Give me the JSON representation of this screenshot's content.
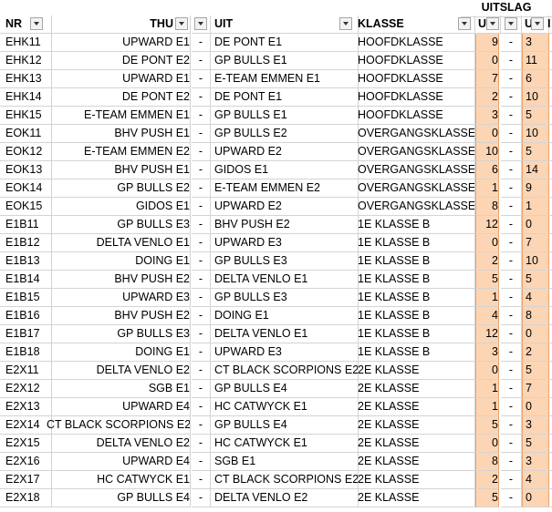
{
  "header": {
    "uitslag": "UITSLAG",
    "nr": "NR",
    "thuis": "THU",
    "uit": "UIT",
    "klasse": "KLASSE",
    "u1": "U",
    "u2": "U",
    "x": "I"
  },
  "highlight_color": "#fcd5b4",
  "rows": [
    {
      "nr": "EHK11",
      "thuis": "UPWARD E1",
      "sep": "-",
      "uit": "DE PONT E1",
      "klasse": "HOOFDKLASSE",
      "u1": "9",
      "dash": "-",
      "u2": "3"
    },
    {
      "nr": "EHK12",
      "thuis": "DE PONT E2",
      "sep": "-",
      "uit": "GP BULLS E1",
      "klasse": "HOOFDKLASSE",
      "u1": "0",
      "dash": "-",
      "u2": "11"
    },
    {
      "nr": "EHK13",
      "thuis": "UPWARD E1",
      "sep": "-",
      "uit": "E-TEAM EMMEN E1",
      "klasse": "HOOFDKLASSE",
      "u1": "7",
      "dash": "-",
      "u2": "6"
    },
    {
      "nr": "EHK14",
      "thuis": "DE PONT E2",
      "sep": "-",
      "uit": "DE PONT E1",
      "klasse": "HOOFDKLASSE",
      "u1": "2",
      "dash": "-",
      "u2": "10"
    },
    {
      "nr": "EHK15",
      "thuis": "E-TEAM EMMEN E1",
      "sep": "-",
      "uit": "GP BULLS E1",
      "klasse": "HOOFDKLASSE",
      "u1": "3",
      "dash": "-",
      "u2": "5"
    },
    {
      "nr": "EOK11",
      "thuis": "BHV PUSH E1",
      "sep": "-",
      "uit": "GP BULLS E2",
      "klasse": "OVERGANGSKLASSE",
      "u1": "0",
      "dash": "-",
      "u2": "10"
    },
    {
      "nr": "EOK12",
      "thuis": "E-TEAM EMMEN E2",
      "sep": "-",
      "uit": "UPWARD E2",
      "klasse": "OVERGANGSKLASSE",
      "u1": "10",
      "dash": "-",
      "u2": "5"
    },
    {
      "nr": "EOK13",
      "thuis": "BHV PUSH E1",
      "sep": "-",
      "uit": "GIDOS E1",
      "klasse": "OVERGANGSKLASSE",
      "u1": "6",
      "dash": "-",
      "u2": "14"
    },
    {
      "nr": "EOK14",
      "thuis": "GP BULLS E2",
      "sep": "-",
      "uit": "E-TEAM EMMEN E2",
      "klasse": "OVERGANGSKLASSE",
      "u1": "1",
      "dash": "-",
      "u2": "9"
    },
    {
      "nr": "EOK15",
      "thuis": "GIDOS E1",
      "sep": "-",
      "uit": "UPWARD E2",
      "klasse": "OVERGANGSKLASSE",
      "u1": "8",
      "dash": "-",
      "u2": "1"
    },
    {
      "nr": "E1B11",
      "thuis": "GP BULLS E3",
      "sep": "-",
      "uit": "BHV PUSH E2",
      "klasse": "1E KLASSE B",
      "u1": "12",
      "dash": "-",
      "u2": "0"
    },
    {
      "nr": "E1B12",
      "thuis": "DELTA VENLO E1",
      "sep": "-",
      "uit": "UPWARD E3",
      "klasse": "1E KLASSE B",
      "u1": "0",
      "dash": "-",
      "u2": "7"
    },
    {
      "nr": "E1B13",
      "thuis": "DOING E1",
      "sep": "-",
      "uit": "GP BULLS E3",
      "klasse": "1E KLASSE B",
      "u1": "2",
      "dash": "-",
      "u2": "10"
    },
    {
      "nr": "E1B14",
      "thuis": "BHV PUSH E2",
      "sep": "-",
      "uit": "DELTA VENLO E1",
      "klasse": "1E KLASSE B",
      "u1": "5",
      "dash": "-",
      "u2": "5"
    },
    {
      "nr": "E1B15",
      "thuis": "UPWARD E3",
      "sep": "-",
      "uit": "GP BULLS E3",
      "klasse": "1E KLASSE B",
      "u1": "1",
      "dash": "-",
      "u2": "4"
    },
    {
      "nr": "E1B16",
      "thuis": "BHV PUSH E2",
      "sep": "-",
      "uit": "DOING E1",
      "klasse": "1E KLASSE B",
      "u1": "4",
      "dash": "-",
      "u2": "8"
    },
    {
      "nr": "E1B17",
      "thuis": "GP BULLS E3",
      "sep": "-",
      "uit": "DELTA VENLO E1",
      "klasse": "1E KLASSE B",
      "u1": "12",
      "dash": "-",
      "u2": "0"
    },
    {
      "nr": "E1B18",
      "thuis": "DOING E1",
      "sep": "-",
      "uit": "UPWARD E3",
      "klasse": "1E KLASSE B",
      "u1": "3",
      "dash": "-",
      "u2": "2"
    },
    {
      "nr": "E2X11",
      "thuis": "DELTA VENLO E2",
      "sep": "-",
      "uit": "CT BLACK SCORPIONS E2",
      "klasse": "2E KLASSE",
      "u1": "0",
      "dash": "-",
      "u2": "5"
    },
    {
      "nr": "E2X12",
      "thuis": "SGB E1",
      "sep": "-",
      "uit": "GP BULLS E4",
      "klasse": "2E KLASSE",
      "u1": "1",
      "dash": "-",
      "u2": "7"
    },
    {
      "nr": "E2X13",
      "thuis": "UPWARD E4",
      "sep": "-",
      "uit": "HC CATWYCK E1",
      "klasse": "2E KLASSE",
      "u1": "1",
      "dash": "-",
      "u2": "0"
    },
    {
      "nr": "E2X14",
      "thuis": "CT BLACK SCORPIONS E2",
      "sep": "-",
      "uit": "GP BULLS E4",
      "klasse": "2E KLASSE",
      "u1": "5",
      "dash": "-",
      "u2": "3"
    },
    {
      "nr": "E2X15",
      "thuis": "DELTA VENLO E2",
      "sep": "-",
      "uit": "HC CATWYCK E1",
      "klasse": "2E KLASSE",
      "u1": "0",
      "dash": "-",
      "u2": "5"
    },
    {
      "nr": "E2X16",
      "thuis": "UPWARD E4",
      "sep": "-",
      "uit": "SGB E1",
      "klasse": "2E KLASSE",
      "u1": "8",
      "dash": "-",
      "u2": "3"
    },
    {
      "nr": "E2X17",
      "thuis": "HC CATWYCK E1",
      "sep": "-",
      "uit": "CT BLACK SCORPIONS E2",
      "klasse": "2E KLASSE",
      "u1": "2",
      "dash": "-",
      "u2": "4"
    },
    {
      "nr": "E2X18",
      "thuis": "GP BULLS E4",
      "sep": "-",
      "uit": "DELTA VENLO E2",
      "klasse": "2E KLASSE",
      "u1": "5",
      "dash": "-",
      "u2": "0"
    }
  ]
}
